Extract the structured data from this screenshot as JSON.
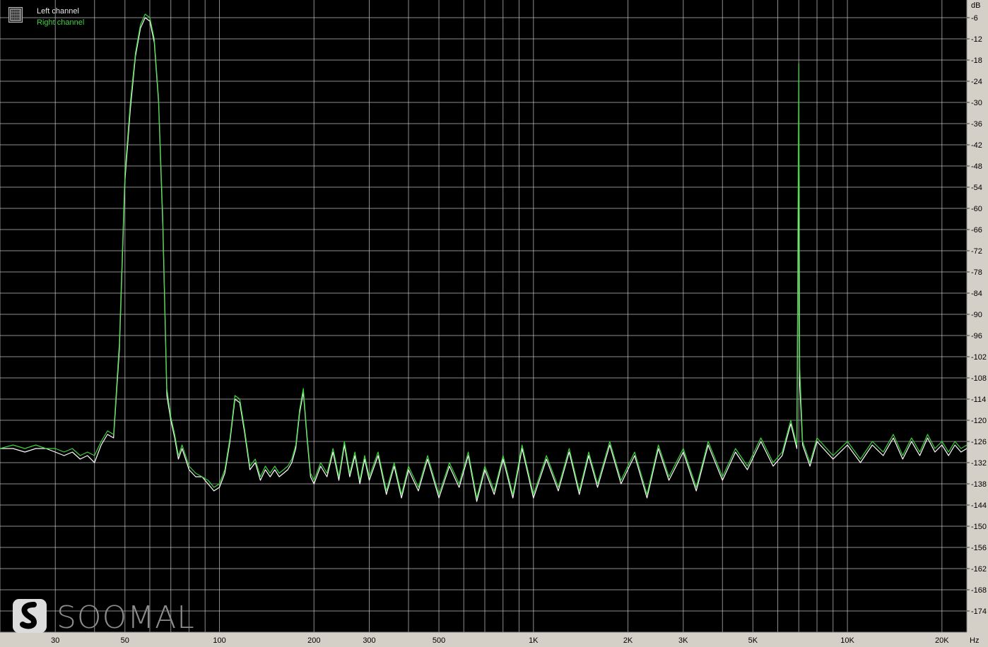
{
  "legend": {
    "left_label": "Left channel",
    "right_label": "Right channel"
  },
  "watermark": {
    "text": "SOOMAL"
  },
  "colors": {
    "background": "#000000",
    "grid": "#c8c8c8",
    "left_channel": "#ffffff",
    "right_channel": "#3cd33c",
    "axis_panel": "#d4d0c8",
    "axis_text": "#000000"
  },
  "chart_data": {
    "type": "line",
    "title": "",
    "xlabel": "Hz",
    "ylabel": "dB",
    "x_scale": "log",
    "xlim": [
      20,
      24000
    ],
    "ylim": [
      -180,
      -1
    ],
    "grid": true,
    "legend_position": "top-left",
    "x_ticks": [
      {
        "value": 30,
        "label": "30"
      },
      {
        "value": 50,
        "label": "50"
      },
      {
        "value": 100,
        "label": "100"
      },
      {
        "value": 200,
        "label": "200"
      },
      {
        "value": 300,
        "label": "300"
      },
      {
        "value": 500,
        "label": "500"
      },
      {
        "value": 1000,
        "label": "1K"
      },
      {
        "value": 2000,
        "label": "2K"
      },
      {
        "value": 3000,
        "label": "3K"
      },
      {
        "value": 5000,
        "label": "5K"
      },
      {
        "value": 10000,
        "label": "10K"
      },
      {
        "value": 20000,
        "label": "20K"
      }
    ],
    "y_ticks": [
      {
        "value": -6,
        "label": "-6"
      },
      {
        "value": -12,
        "label": "-12"
      },
      {
        "value": -18,
        "label": "-18"
      },
      {
        "value": -24,
        "label": "-24"
      },
      {
        "value": -30,
        "label": "-30"
      },
      {
        "value": -36,
        "label": "-36"
      },
      {
        "value": -42,
        "label": "-42"
      },
      {
        "value": -48,
        "label": "-48"
      },
      {
        "value": -54,
        "label": "-54"
      },
      {
        "value": -60,
        "label": "-60"
      },
      {
        "value": -66,
        "label": "-66"
      },
      {
        "value": -72,
        "label": "-72"
      },
      {
        "value": -78,
        "label": "-78"
      },
      {
        "value": -84,
        "label": "-84"
      },
      {
        "value": -90,
        "label": "-90"
      },
      {
        "value": -96,
        "label": "-96"
      },
      {
        "value": -102,
        "label": "-102"
      },
      {
        "value": -108,
        "label": "-108"
      },
      {
        "value": -114,
        "label": "-114"
      },
      {
        "value": -120,
        "label": "-120"
      },
      {
        "value": -126,
        "label": "-126"
      },
      {
        "value": -132,
        "label": "-132"
      },
      {
        "value": -138,
        "label": "-138"
      },
      {
        "value": -144,
        "label": "-144"
      },
      {
        "value": -150,
        "label": "-150"
      },
      {
        "value": -156,
        "label": "-156"
      },
      {
        "value": -162,
        "label": "-162"
      },
      {
        "value": -168,
        "label": "-168"
      },
      {
        "value": -174,
        "label": "-174"
      }
    ],
    "series": [
      {
        "name": "Left channel",
        "color": "#ffffff",
        "points": [
          [
            20,
            -128
          ],
          [
            22,
            -128
          ],
          [
            24,
            -129
          ],
          [
            26,
            -128
          ],
          [
            28,
            -128
          ],
          [
            30,
            -129
          ],
          [
            32,
            -130
          ],
          [
            34,
            -129
          ],
          [
            36,
            -131
          ],
          [
            38,
            -130
          ],
          [
            40,
            -132
          ],
          [
            42,
            -127
          ],
          [
            44,
            -124
          ],
          [
            46,
            -125
          ],
          [
            48,
            -100
          ],
          [
            50,
            -52
          ],
          [
            52,
            -32
          ],
          [
            54,
            -17
          ],
          [
            56,
            -9
          ],
          [
            58,
            -6
          ],
          [
            60,
            -7
          ],
          [
            62,
            -13
          ],
          [
            64,
            -30
          ],
          [
            66,
            -65
          ],
          [
            68,
            -113
          ],
          [
            70,
            -120
          ],
          [
            72,
            -125
          ],
          [
            74,
            -131
          ],
          [
            76,
            -128
          ],
          [
            78,
            -131
          ],
          [
            80,
            -134
          ],
          [
            84,
            -136
          ],
          [
            88,
            -136
          ],
          [
            92,
            -138
          ],
          [
            96,
            -140
          ],
          [
            100,
            -139
          ],
          [
            104,
            -135
          ],
          [
            108,
            -126
          ],
          [
            112,
            -114
          ],
          [
            116,
            -115
          ],
          [
            120,
            -123
          ],
          [
            125,
            -134
          ],
          [
            130,
            -132
          ],
          [
            135,
            -137
          ],
          [
            140,
            -134
          ],
          [
            145,
            -136
          ],
          [
            150,
            -134
          ],
          [
            155,
            -136
          ],
          [
            160,
            -135
          ],
          [
            165,
            -134
          ],
          [
            170,
            -132
          ],
          [
            175,
            -128
          ],
          [
            180,
            -118
          ],
          [
            185,
            -112
          ],
          [
            190,
            -125
          ],
          [
            195,
            -136
          ],
          [
            200,
            -138
          ],
          [
            210,
            -133
          ],
          [
            220,
            -136
          ],
          [
            230,
            -129
          ],
          [
            240,
            -137
          ],
          [
            250,
            -127
          ],
          [
            260,
            -136
          ],
          [
            270,
            -130
          ],
          [
            280,
            -138
          ],
          [
            290,
            -131
          ],
          [
            300,
            -137
          ],
          [
            320,
            -130
          ],
          [
            340,
            -141
          ],
          [
            360,
            -133
          ],
          [
            380,
            -142
          ],
          [
            400,
            -134
          ],
          [
            430,
            -140
          ],
          [
            460,
            -131
          ],
          [
            500,
            -142
          ],
          [
            540,
            -133
          ],
          [
            580,
            -139
          ],
          [
            620,
            -130
          ],
          [
            660,
            -143
          ],
          [
            700,
            -134
          ],
          [
            750,
            -141
          ],
          [
            800,
            -131
          ],
          [
            860,
            -142
          ],
          [
            920,
            -128
          ],
          [
            1000,
            -142
          ],
          [
            1100,
            -131
          ],
          [
            1200,
            -140
          ],
          [
            1300,
            -129
          ],
          [
            1400,
            -141
          ],
          [
            1500,
            -130
          ],
          [
            1600,
            -139
          ],
          [
            1750,
            -127
          ],
          [
            1900,
            -138
          ],
          [
            2100,
            -130
          ],
          [
            2300,
            -142
          ],
          [
            2500,
            -128
          ],
          [
            2700,
            -137
          ],
          [
            3000,
            -129
          ],
          [
            3300,
            -140
          ],
          [
            3600,
            -127
          ],
          [
            4000,
            -137
          ],
          [
            4400,
            -129
          ],
          [
            4800,
            -134
          ],
          [
            5300,
            -126
          ],
          [
            5800,
            -133
          ],
          [
            6200,
            -130
          ],
          [
            6600,
            -121
          ],
          [
            6900,
            -128
          ],
          [
            7000,
            -40
          ],
          [
            7050,
            -110
          ],
          [
            7200,
            -127
          ],
          [
            7600,
            -133
          ],
          [
            8000,
            -126
          ],
          [
            9000,
            -131
          ],
          [
            10000,
            -127
          ],
          [
            11000,
            -132
          ],
          [
            12000,
            -127
          ],
          [
            13000,
            -130
          ],
          [
            14000,
            -125
          ],
          [
            15000,
            -131
          ],
          [
            16000,
            -126
          ],
          [
            17000,
            -130
          ],
          [
            18000,
            -125
          ],
          [
            19000,
            -129
          ],
          [
            20000,
            -127
          ],
          [
            21000,
            -130
          ],
          [
            22000,
            -127
          ],
          [
            23000,
            -129
          ],
          [
            24000,
            -128
          ]
        ]
      },
      {
        "name": "Right channel",
        "color": "#3cd33c",
        "points": [
          [
            20,
            -128
          ],
          [
            22,
            -127
          ],
          [
            24,
            -128
          ],
          [
            26,
            -127
          ],
          [
            28,
            -128
          ],
          [
            30,
            -128
          ],
          [
            32,
            -129
          ],
          [
            34,
            -128
          ],
          [
            36,
            -130
          ],
          [
            38,
            -129
          ],
          [
            40,
            -130
          ],
          [
            42,
            -126
          ],
          [
            44,
            -123
          ],
          [
            46,
            -124
          ],
          [
            48,
            -98
          ],
          [
            50,
            -50
          ],
          [
            52,
            -30
          ],
          [
            54,
            -16
          ],
          [
            56,
            -8
          ],
          [
            58,
            -5
          ],
          [
            60,
            -6
          ],
          [
            62,
            -12
          ],
          [
            64,
            -29
          ],
          [
            66,
            -63
          ],
          [
            68,
            -111
          ],
          [
            70,
            -119
          ],
          [
            72,
            -124
          ],
          [
            74,
            -130
          ],
          [
            76,
            -127
          ],
          [
            78,
            -130
          ],
          [
            80,
            -133
          ],
          [
            84,
            -135
          ],
          [
            88,
            -136
          ],
          [
            92,
            -137
          ],
          [
            96,
            -139
          ],
          [
            100,
            -138
          ],
          [
            104,
            -134
          ],
          [
            108,
            -125
          ],
          [
            112,
            -113
          ],
          [
            116,
            -114
          ],
          [
            120,
            -122
          ],
          [
            125,
            -133
          ],
          [
            130,
            -131
          ],
          [
            135,
            -136
          ],
          [
            140,
            -133
          ],
          [
            145,
            -135
          ],
          [
            150,
            -133
          ],
          [
            155,
            -135
          ],
          [
            160,
            -134
          ],
          [
            165,
            -133
          ],
          [
            170,
            -131
          ],
          [
            175,
            -127
          ],
          [
            180,
            -117
          ],
          [
            185,
            -111
          ],
          [
            190,
            -124
          ],
          [
            195,
            -135
          ],
          [
            200,
            -137
          ],
          [
            210,
            -132
          ],
          [
            220,
            -135
          ],
          [
            230,
            -128
          ],
          [
            240,
            -136
          ],
          [
            250,
            -126
          ],
          [
            260,
            -135
          ],
          [
            270,
            -129
          ],
          [
            280,
            -137
          ],
          [
            290,
            -130
          ],
          [
            300,
            -136
          ],
          [
            320,
            -129
          ],
          [
            340,
            -140
          ],
          [
            360,
            -132
          ],
          [
            380,
            -141
          ],
          [
            400,
            -133
          ],
          [
            430,
            -139
          ],
          [
            460,
            -130
          ],
          [
            500,
            -141
          ],
          [
            540,
            -132
          ],
          [
            580,
            -138
          ],
          [
            620,
            -129
          ],
          [
            660,
            -142
          ],
          [
            700,
            -133
          ],
          [
            750,
            -140
          ],
          [
            800,
            -130
          ],
          [
            860,
            -141
          ],
          [
            920,
            -127
          ],
          [
            1000,
            -141
          ],
          [
            1100,
            -130
          ],
          [
            1200,
            -139
          ],
          [
            1300,
            -128
          ],
          [
            1400,
            -140
          ],
          [
            1500,
            -129
          ],
          [
            1600,
            -138
          ],
          [
            1750,
            -126
          ],
          [
            1900,
            -137
          ],
          [
            2100,
            -129
          ],
          [
            2300,
            -141
          ],
          [
            2500,
            -127
          ],
          [
            2700,
            -136
          ],
          [
            3000,
            -128
          ],
          [
            3300,
            -139
          ],
          [
            3600,
            -126
          ],
          [
            4000,
            -136
          ],
          [
            4400,
            -128
          ],
          [
            4800,
            -133
          ],
          [
            5300,
            -125
          ],
          [
            5800,
            -132
          ],
          [
            6200,
            -129
          ],
          [
            6600,
            -120
          ],
          [
            6900,
            -127
          ],
          [
            7000,
            -19
          ],
          [
            7050,
            -105
          ],
          [
            7200,
            -126
          ],
          [
            7600,
            -132
          ],
          [
            8000,
            -125
          ],
          [
            9000,
            -130
          ],
          [
            10000,
            -126
          ],
          [
            11000,
            -131
          ],
          [
            12000,
            -126
          ],
          [
            13000,
            -129
          ],
          [
            14000,
            -124
          ],
          [
            15000,
            -130
          ],
          [
            16000,
            -125
          ],
          [
            17000,
            -129
          ],
          [
            18000,
            -124
          ],
          [
            19000,
            -128
          ],
          [
            20000,
            -126
          ],
          [
            21000,
            -129
          ],
          [
            22000,
            -126
          ],
          [
            23000,
            -128
          ],
          [
            24000,
            -127
          ]
        ]
      }
    ]
  }
}
